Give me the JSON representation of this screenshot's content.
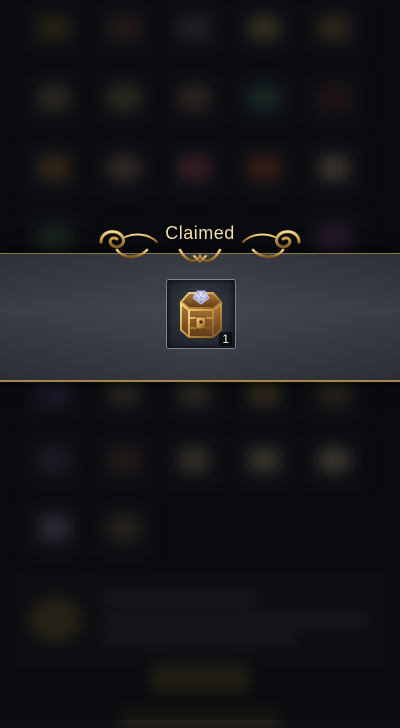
{
  "popup": {
    "title": "Claimed",
    "accent_color": "#c9a25a",
    "title_color": "#f2dfaa"
  },
  "reward": {
    "icon": "treasure-chest-icon",
    "quantity": "1"
  }
}
